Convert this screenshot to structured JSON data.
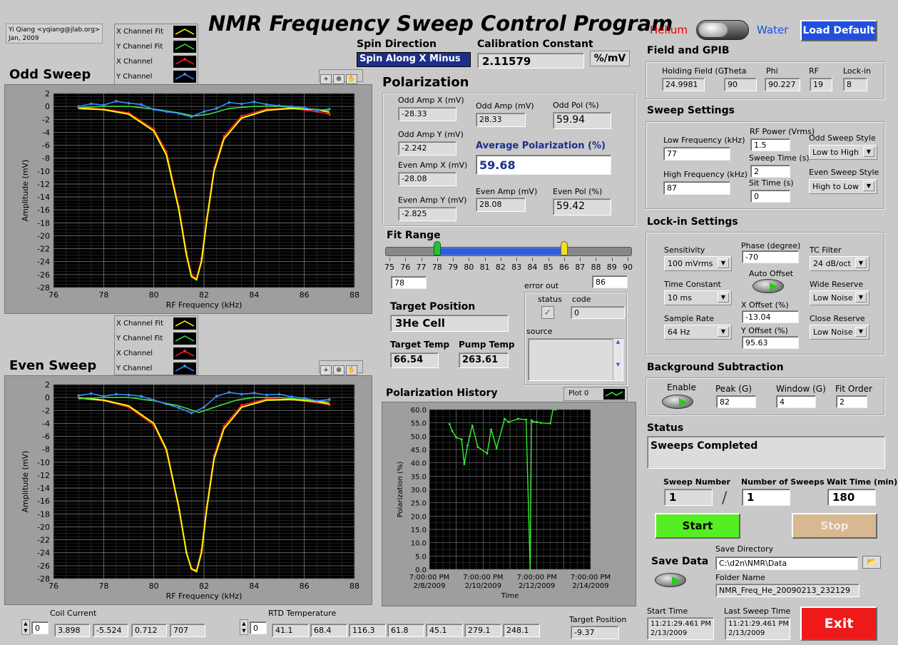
{
  "title": "NMR Frequency Sweep Control Program",
  "author": {
    "line1": "Yi Qiang <yqiang@jlab.org>",
    "line2": "Jan, 2009"
  },
  "mode": {
    "helium": "Helium",
    "water": "Water",
    "load_default": "Load Default"
  },
  "spin": {
    "label": "Spin Direction",
    "value": "Spin Along X Minus"
  },
  "calib": {
    "label": "Calibration Constant",
    "value": "2.11579",
    "unit": "%/mV"
  },
  "legend": {
    "items": [
      "X Channel Fit",
      "Y Channel Fit",
      "X Channel",
      "Y Channel"
    ]
  },
  "odd_graph": {
    "title": "Odd Sweep",
    "xlabel": "RF Frequency (kHz)",
    "ylabel": "Amplitude (mV)"
  },
  "even_graph": {
    "title": "Even Sweep",
    "xlabel": "RF Frequency (kHz)",
    "ylabel": "Amplitude (mV)"
  },
  "sweep_xticks": [
    "76",
    "78",
    "80",
    "82",
    "84",
    "86",
    "88"
  ],
  "sweep_yticks": [
    "2",
    "0",
    "-2",
    "-4",
    "-6",
    "-8",
    "-10",
    "-12",
    "-14",
    "-16",
    "-18",
    "-20",
    "-22",
    "-24",
    "-26",
    "-28"
  ],
  "polarization": {
    "title": "Polarization",
    "odd_amp_x_label": "Odd Amp X (mV)",
    "odd_amp_x": "-28.33",
    "odd_amp_y_label": "Odd Amp Y (mV)",
    "odd_amp_y": "-2.242",
    "even_amp_x_label": "Even Amp X (mV)",
    "even_amp_x": "-28.08",
    "even_amp_y_label": "Even Amp Y (mV)",
    "even_amp_y": "-2.825",
    "odd_amp_label": "Odd Amp (mV)",
    "odd_amp": "28.33",
    "odd_pol_label": "Odd Pol (%)",
    "odd_pol": "59.94",
    "avg_label": "Average Polarization (%)",
    "avg": "59.68",
    "even_amp_label": "Even Amp (mV)",
    "even_amp": "28.08",
    "even_pol_label": "Even Pol (%)",
    "even_pol": "59.42"
  },
  "fit_range": {
    "label": "Fit Range",
    "ticks": [
      "75",
      "76",
      "77",
      "78",
      "79",
      "80",
      "81",
      "82",
      "83",
      "84",
      "85",
      "86",
      "87",
      "88",
      "89",
      "90"
    ],
    "low": "78",
    "high": "86",
    "low_value": 78,
    "high_value": 86,
    "min": 75,
    "max": 90
  },
  "error_out": {
    "label": "error out",
    "status": "status",
    "code": "code",
    "code_value": "0",
    "source": "source"
  },
  "target": {
    "pos_label": "Target Position",
    "pos_value": "3He Cell",
    "temp_label": "Target Temp",
    "temp": "66.54",
    "pump_label": "Pump Temp",
    "pump": "263.61"
  },
  "history": {
    "title": "Polarization History",
    "plot_label": "Plot 0",
    "xlabel": "Time",
    "ylabel": "Polarization (%)",
    "yticks": [
      "60.0",
      "55.0",
      "50.0",
      "45.0",
      "40.0",
      "35.0",
      "30.0",
      "25.0",
      "20.0",
      "15.0",
      "10.0",
      "5.0",
      "0.0"
    ],
    "xticks": [
      [
        "7:00:00 PM",
        "2/8/2009"
      ],
      [
        "7:00:00 PM",
        "2/10/2009"
      ],
      [
        "7:00:00 PM",
        "2/12/2009"
      ],
      [
        "7:00:00 PM",
        "2/14/2009"
      ]
    ]
  },
  "field": {
    "title": "Field and GPIB",
    "holding_label": "Holding Field (G)",
    "holding": "24.9981",
    "theta_label": "Theta",
    "theta": "90",
    "phi_label": "Phi",
    "phi": "90.227",
    "rf_label": "RF",
    "rf": "19",
    "lockin_label": "Lock-in",
    "lockin": "8"
  },
  "sweep": {
    "title": "Sweep Settings",
    "low_label": "Low Frequency (kHz)",
    "low": "77",
    "high_label": "High Frequency (kHz)",
    "high": "87",
    "rfpow_label": "RF Power (Vrms)",
    "rfpow": "1.5",
    "stime_label": "Sweep Time (s)",
    "stime": "2",
    "sit_label": "Sit Time (s)",
    "sit": "0",
    "odd_style_label": "Odd Sweep Style",
    "odd_style": "Low to High",
    "even_style_label": "Even Sweep Style",
    "even_style": "High to Low"
  },
  "lockin": {
    "title": "Lock-in Settings",
    "sens_label": "Sensitivity",
    "sens": "100 mVrms",
    "phase_label": "Phase (degree)",
    "phase": "-70",
    "tc_label": "TC Filter",
    "tc": "24 dB/oct",
    "auto_label": "Auto Offset",
    "timec_label": "Time Constant",
    "timec": "10 ms",
    "xoff_label": "X Offset (%)",
    "xoff": "-13.04",
    "wide_label": "Wide Reserve",
    "wide": "Low Noise",
    "rate_label": "Sample Rate",
    "rate": "64 Hz",
    "yoff_label": "Y Offset (%)",
    "yoff": "95.63",
    "close_label": "Close Reserve",
    "close": "Low Noise"
  },
  "bg": {
    "title": "Background Subtraction",
    "enable_label": "Enable",
    "peak_label": "Peak (G)",
    "peak": "82",
    "window_label": "Window (G)",
    "window": "4",
    "order_label": "Fit Order",
    "order": "2"
  },
  "status": {
    "title": "Status",
    "text": "Sweeps Completed"
  },
  "run": {
    "num_label": "Sweep Number",
    "num": "1",
    "count_label": "Number of Sweeps",
    "count": "1",
    "sep": "/",
    "wait_label": "Wait Time (min)",
    "wait": "180",
    "start": "Start",
    "stop": "Stop"
  },
  "save": {
    "label": "Save Data",
    "dir_label": "Save Directory",
    "dir": "C:\\d2n\\NMR\\Data",
    "folder_label": "Folder Name",
    "folder": "NMR_Freq_He_20090213_232129"
  },
  "times": {
    "start_label": "Start Time",
    "start_l1": "11:21:29.461 PM",
    "start_l2": "2/13/2009",
    "last_label": "Last Sweep Time",
    "last_l1": "11:21:29.461 PM",
    "last_l2": "2/13/2009",
    "exit": "Exit"
  },
  "coil": {
    "label": "Coil Current",
    "index": "0",
    "values": [
      "3.898",
      "-5.524",
      "0.712",
      "707"
    ]
  },
  "rtd": {
    "label": "RTD Temperature",
    "index": "0",
    "values": [
      "41.1",
      "68.4",
      "116.3",
      "61.8",
      "45.1",
      "279.1",
      "248.1"
    ]
  },
  "tpos": {
    "label": "Target Position",
    "value": "-9.37"
  },
  "colors": {
    "x_fit": "#ffff00",
    "y_fit": "#40e040",
    "x_ch": "#ff2020",
    "y_ch": "#3a8cff",
    "history": "#33ee33"
  },
  "chart_data": [
    {
      "type": "line",
      "title": "Odd Sweep",
      "xlabel": "RF Frequency (kHz)",
      "ylabel": "Amplitude (mV)",
      "xlim": [
        76,
        88
      ],
      "ylim": [
        -28,
        2
      ],
      "grid": true,
      "series": [
        {
          "name": "X Channel Fit",
          "x": [
            77,
            78,
            79,
            80,
            80.5,
            81,
            81.3,
            81.5,
            81.7,
            81.9,
            82.1,
            82.4,
            82.8,
            83.5,
            84.5,
            85.5,
            86.5,
            87
          ],
          "y": [
            -0.3,
            -0.5,
            -1.2,
            -3.8,
            -7.5,
            -16,
            -23,
            -26.3,
            -26.8,
            -24,
            -18,
            -10,
            -5,
            -1.8,
            -0.6,
            -0.3,
            -0.5,
            -0.9
          ]
        },
        {
          "name": "Y Channel Fit",
          "x": [
            77,
            78,
            79,
            80,
            81,
            81.6,
            82.2,
            83,
            84,
            85,
            86,
            87
          ],
          "y": [
            -0.2,
            0,
            0,
            -0.4,
            -1,
            -1.5,
            -1.2,
            -0.3,
            0,
            0,
            -0.3,
            -0.6
          ]
        },
        {
          "name": "X Channel",
          "x": [
            77,
            78,
            79,
            80,
            80.5,
            81,
            81.3,
            81.5,
            81.7,
            81.9,
            82.1,
            82.4,
            82.8,
            83.5,
            84.5,
            85.5,
            86.5,
            87
          ],
          "y": [
            -0.2,
            -0.4,
            -1,
            -3.5,
            -7,
            -15.5,
            -22.5,
            -26,
            -26.6,
            -23.5,
            -17.5,
            -9.5,
            -4.6,
            -1.5,
            -0.4,
            -0.3,
            -0.8,
            -1.2
          ]
        },
        {
          "name": "Y Channel",
          "x": [
            77,
            77.5,
            78,
            78.5,
            79,
            79.5,
            80,
            80.5,
            81,
            81.5,
            82,
            82.5,
            83,
            83.5,
            84,
            84.5,
            85,
            85.5,
            86,
            86.5,
            87
          ],
          "y": [
            0,
            0.4,
            0.2,
            0.8,
            0.5,
            0.3,
            -0.5,
            -0.8,
            -1.1,
            -1.6,
            -0.8,
            -0.3,
            0.6,
            0.4,
            0.7,
            0.3,
            0.1,
            0,
            -0.2,
            -0.6,
            -0.4
          ]
        }
      ]
    },
    {
      "type": "line",
      "title": "Even Sweep",
      "xlabel": "RF Frequency (kHz)",
      "ylabel": "Amplitude (mV)",
      "xlim": [
        76,
        88
      ],
      "ylim": [
        -28,
        2
      ],
      "grid": true,
      "series": [
        {
          "name": "X Channel Fit",
          "x": [
            77,
            78,
            79,
            80,
            80.5,
            81,
            81.3,
            81.5,
            81.7,
            81.9,
            82.1,
            82.4,
            82.8,
            83.5,
            84.5,
            85.5,
            86.5,
            87
          ],
          "y": [
            -0.1,
            -0.4,
            -1.3,
            -4,
            -8,
            -17,
            -24,
            -26.5,
            -26.9,
            -24,
            -17.5,
            -9.5,
            -4.8,
            -1.5,
            -0.4,
            -0.3,
            -0.6,
            -1
          ]
        },
        {
          "name": "Y Channel Fit",
          "x": [
            77,
            78,
            79,
            80,
            81,
            81.8,
            82.5,
            83.3,
            84,
            85,
            86,
            87
          ],
          "y": [
            -0.2,
            0,
            0,
            -0.5,
            -1.3,
            -2.3,
            -1.4,
            -0.4,
            0,
            0,
            -0.3,
            -0.7
          ]
        },
        {
          "name": "X Channel",
          "x": [
            77,
            78,
            79,
            80,
            80.5,
            81,
            81.3,
            81.5,
            81.7,
            81.9,
            82.1,
            82.4,
            82.8,
            83.5,
            84.5,
            85.5,
            86.5,
            87
          ],
          "y": [
            0,
            -0.5,
            -1.5,
            -4.3,
            -8.3,
            -17.3,
            -24,
            -26.4,
            -26.7,
            -23.6,
            -17,
            -9,
            -4.4,
            -1.2,
            -0.2,
            -0.3,
            -0.8,
            -1.1
          ]
        },
        {
          "name": "Y Channel",
          "x": [
            77,
            77.5,
            78,
            78.5,
            79,
            79.5,
            80,
            80.5,
            81,
            81.5,
            82,
            82.5,
            83,
            83.5,
            84,
            84.5,
            85,
            85.5,
            86,
            86.5,
            87
          ],
          "y": [
            0.3,
            0.6,
            0.2,
            0.5,
            0.4,
            0.2,
            -0.4,
            -1,
            -1.6,
            -2.4,
            -1.5,
            0.2,
            0.8,
            0.5,
            0.7,
            0.4,
            0.5,
            0.1,
            -0.1,
            -0.5,
            -0.3
          ]
        }
      ]
    },
    {
      "type": "line",
      "title": "Polarization History",
      "xlabel": "Time",
      "ylabel": "Polarization (%)",
      "xlim": [
        0,
        6
      ],
      "ylim": [
        0,
        60
      ],
      "grid": true,
      "series": [
        {
          "name": "Plot 0",
          "x": [
            0.75,
            0.85,
            1.0,
            1.2,
            1.3,
            1.42,
            1.5,
            1.6,
            1.8,
            2.15,
            2.3,
            2.5,
            2.8,
            2.95,
            3.3,
            3.6,
            3.75,
            3.8,
            3.85,
            4.0,
            4.15,
            4.5,
            4.6,
            4.7
          ],
          "y": [
            54.5,
            52,
            49.5,
            48.8,
            39.5,
            46.5,
            50,
            54,
            46,
            43.5,
            52.5,
            45.5,
            56.5,
            55.3,
            56.5,
            56.2,
            0,
            56,
            55.5,
            55.3,
            55,
            54.8,
            60,
            60
          ]
        }
      ]
    }
  ]
}
